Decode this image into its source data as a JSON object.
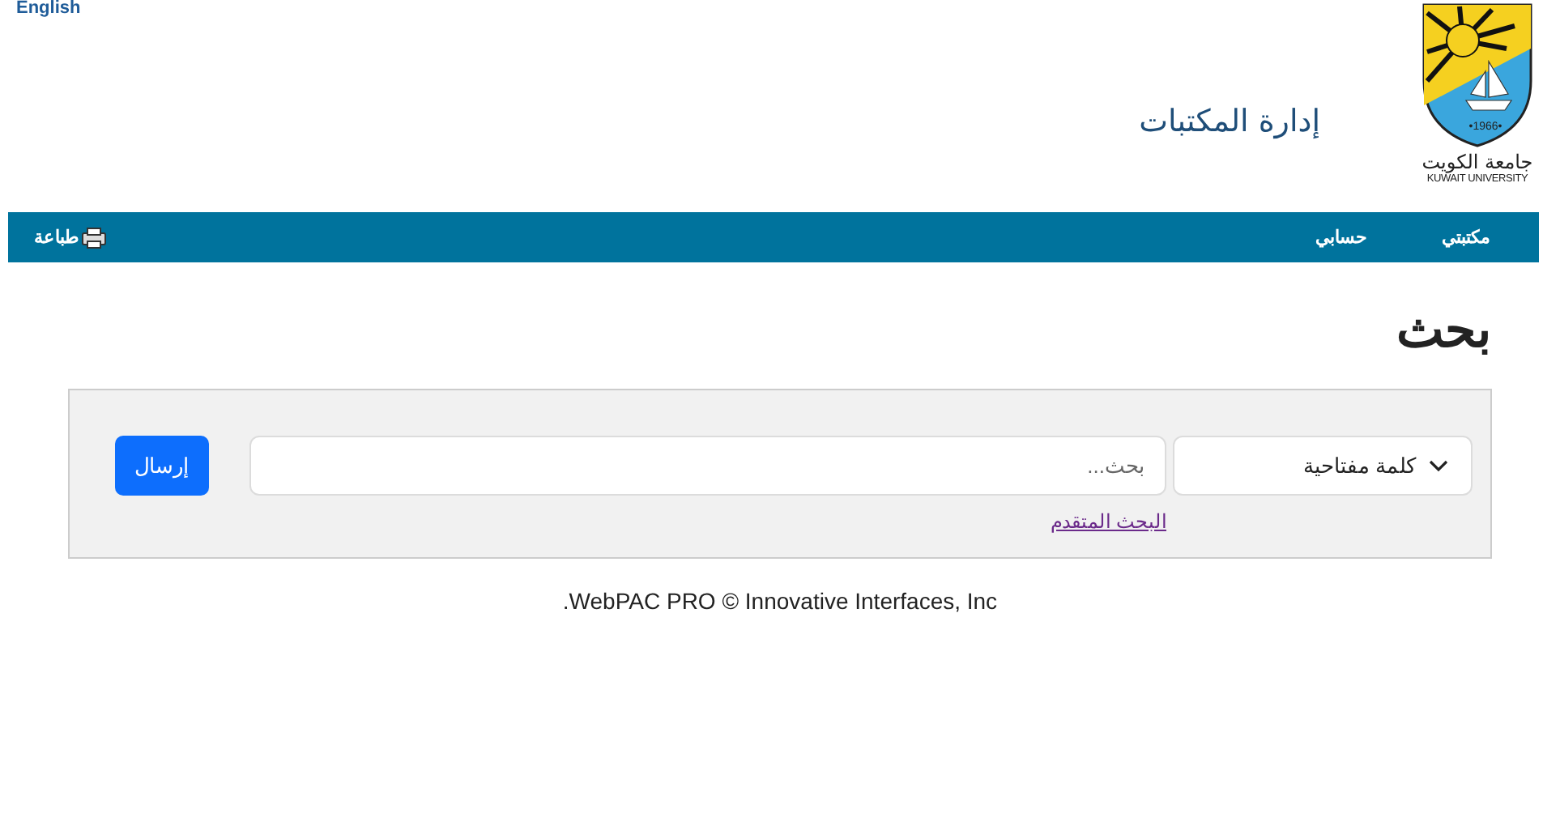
{
  "language_link": "English",
  "header": {
    "title": "إدارة المكتبات",
    "logo": {
      "year": "•1966•",
      "name_ar": "جامعة الكويت",
      "name_en": "KUWAIT UNIVERSITY"
    }
  },
  "navbar": {
    "items": [
      {
        "label": "مكتبتي"
      },
      {
        "label": "حسابي"
      }
    ],
    "print": "طباعة"
  },
  "page_title": "بحث",
  "search": {
    "type_select": "كلمة مفتاحية",
    "placeholder": "بحث...",
    "submit": "إرسال",
    "advanced_link": "البحث المتقدم"
  },
  "footer": ".WebPAC PRO © Innovative Interfaces, Inc"
}
